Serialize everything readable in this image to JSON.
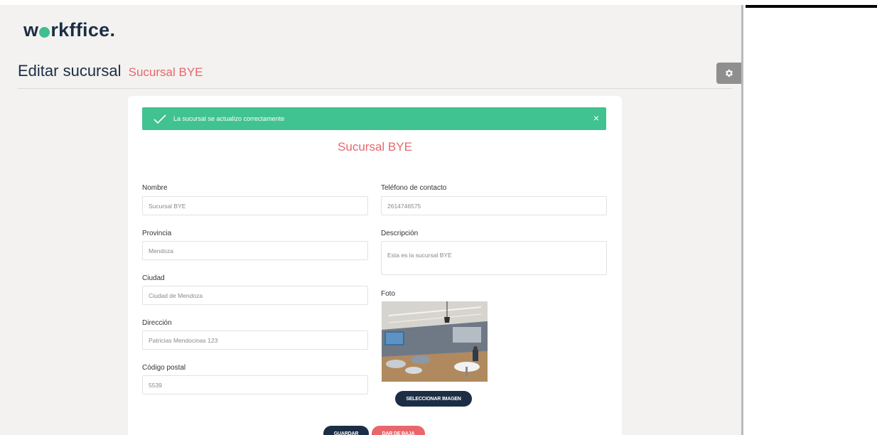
{
  "brand": {
    "logo_left": "w",
    "logo_right": "rkffice."
  },
  "page": {
    "title": "Editar sucursal",
    "subtitle": "Sucursal BYE"
  },
  "alert": {
    "message": "La sucursal se actualizo correctamente",
    "close_label": "×",
    "color": "#41c291"
  },
  "form": {
    "title": "Sucursal BYE",
    "nombre": {
      "label": "Nombre",
      "value": "Sucursal BYE"
    },
    "telefono": {
      "label": "Teléfono de contacto",
      "value": "2614746575"
    },
    "provincia": {
      "label": "Provincia",
      "value": "Mendoza"
    },
    "descripcion": {
      "label": "Descripción",
      "value": "Esta es la sucursal BYE"
    },
    "ciudad": {
      "label": "Ciudad",
      "value": "Ciudad de Mendoza"
    },
    "foto": {
      "label": "Foto",
      "button_label": "SELECCIONAR IMAGEN"
    },
    "direccion": {
      "label": "Dirección",
      "value": "Patricias Mendocinas 123"
    },
    "codigo_postal": {
      "label": "Código postal",
      "value": "5539"
    }
  },
  "actions": {
    "save_label": "GUARDAR",
    "deactivate_label": "DAR DE BAJA"
  },
  "colors": {
    "navy": "#1c2e45",
    "coral": "#e8676c",
    "green": "#41c291",
    "background": "#f3f2f0"
  },
  "icons": {
    "settings": "gear-icon",
    "alert": "check-icon",
    "close": "close-icon"
  }
}
